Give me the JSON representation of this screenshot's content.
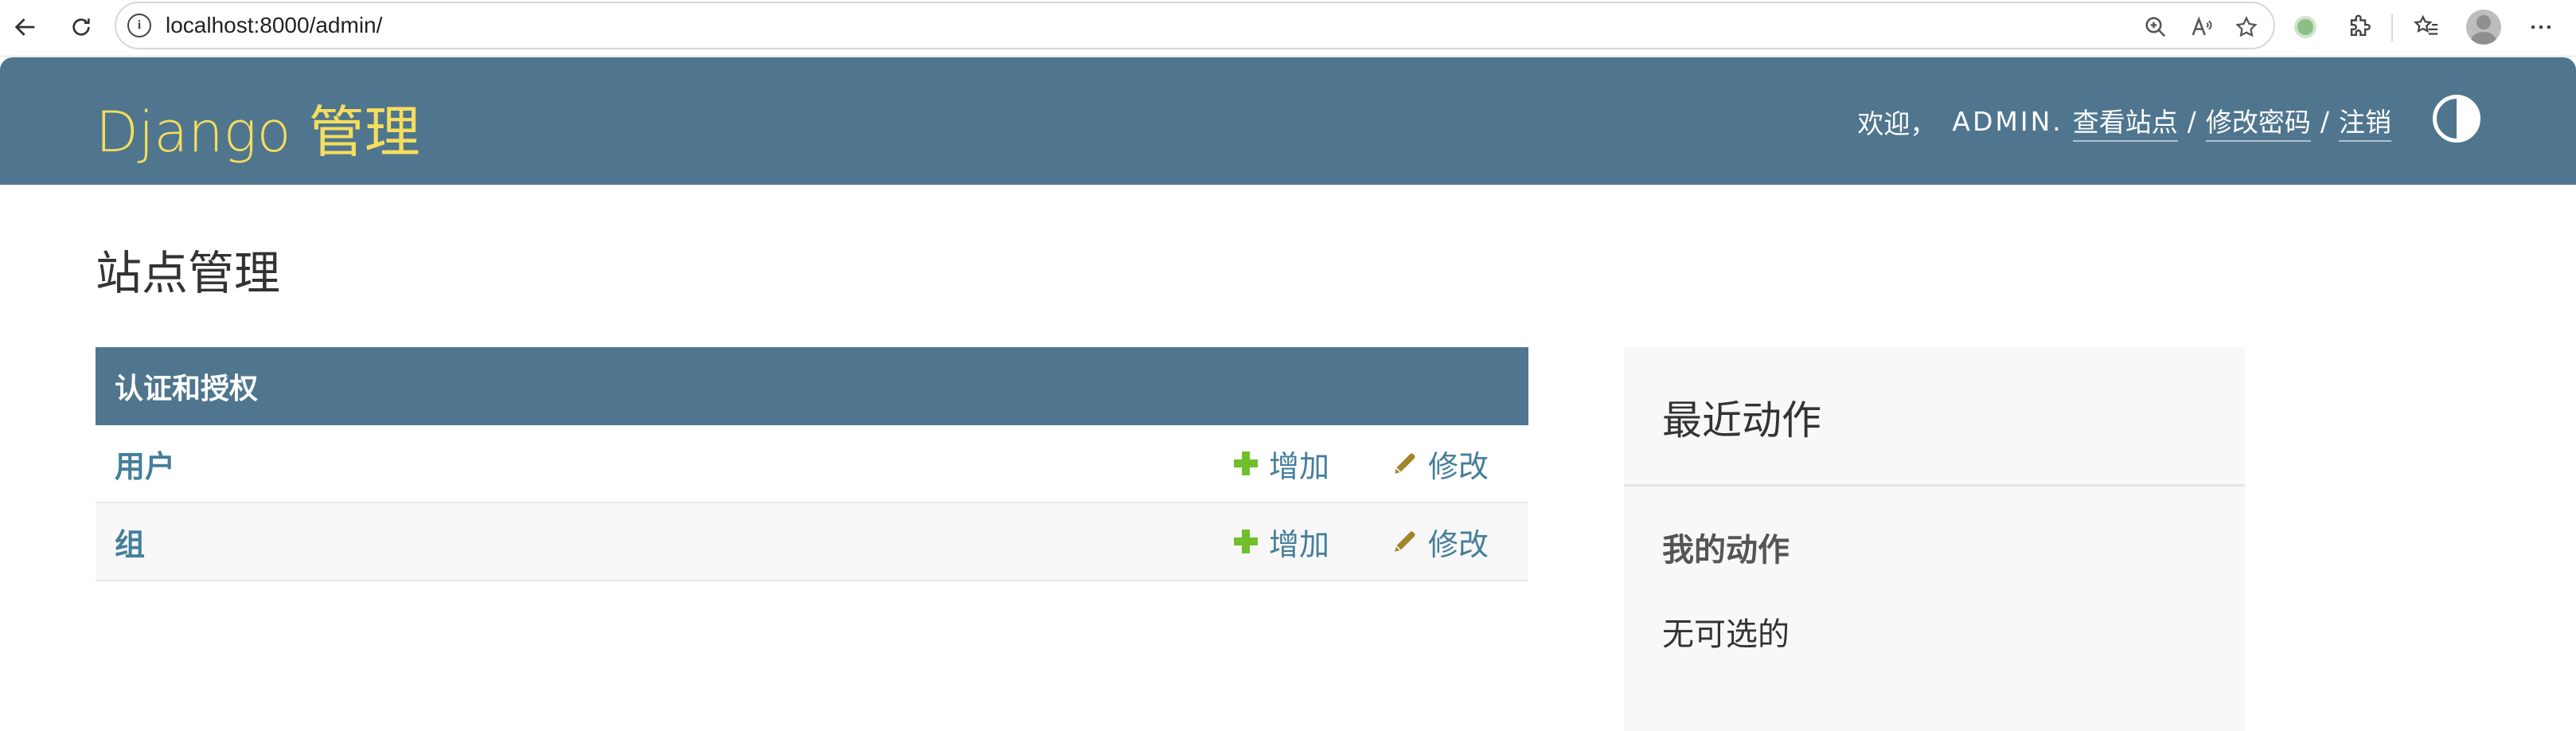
{
  "browser": {
    "url": "localhost:8000/admin/",
    "icons": [
      "back-arrow-icon",
      "refresh-icon",
      "info-icon",
      "zoom-icon",
      "read-aloud-icon",
      "favorite-star-icon",
      "extension-dot-icon",
      "puzzle-icon",
      "favorites-icon",
      "profile-avatar-icon",
      "more-icon"
    ]
  },
  "header": {
    "branding": "Django 管理",
    "welcome": "欢迎，",
    "username": "ADMIN.",
    "view_site": "查看站点",
    "slash1": "/",
    "change_password": "修改密码",
    "slash2": "/",
    "logout": "注销",
    "bg_color": "#4f768e",
    "brand_color": "#f5dd5d"
  },
  "content": {
    "title": "站点管理",
    "app": {
      "caption": "认证和授权",
      "models": [
        {
          "name": "用户",
          "add": "增加",
          "change": "修改"
        },
        {
          "name": "组",
          "add": "增加",
          "change": "修改"
        }
      ]
    }
  },
  "recent_actions": {
    "title": "最近动作",
    "subtitle": "我的动作",
    "empty": "无可选的"
  }
}
